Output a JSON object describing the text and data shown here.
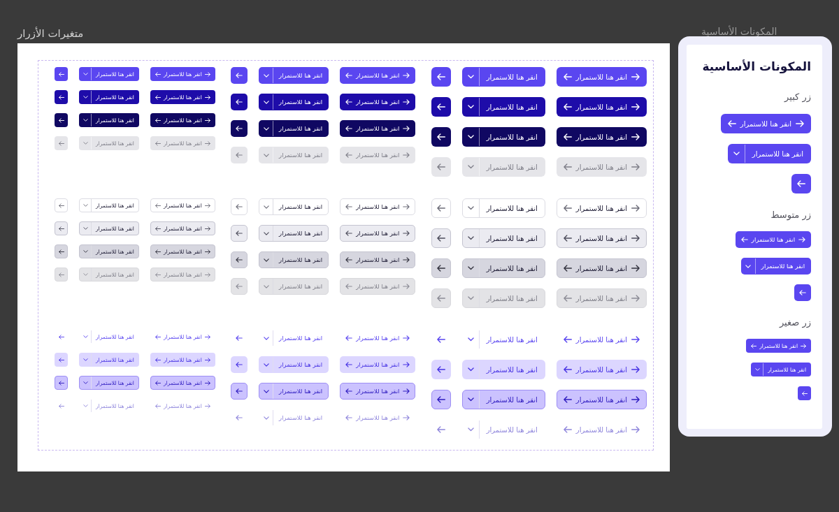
{
  "variants": {
    "title": "متغيرات الأزرار",
    "sections": [
      {
        "kind": "primary",
        "sizes": [
          {
            "kind": "large",
            "rows": [
              {
                "hovered": false,
                "pressed": false,
                "disabled": false,
                "split_label": "انقر هنا للاستمرار",
                "button_label": "انقر هنا للاستمرار"
              },
              {
                "hovered": true,
                "pressed": false,
                "disabled": false,
                "split_label": "انقر هنا للاستمرار",
                "button_label": "انقر هنا للاستمرار"
              },
              {
                "hovered": false,
                "pressed": true,
                "disabled": false,
                "split_label": "انقر هنا للاستمرار",
                "button_label": "انقر هنا للاستمرار"
              },
              {
                "hovered": false,
                "pressed": false,
                "disabled": true,
                "split_label": "انقر هنا للاستمرار",
                "button_label": "انقر هنا للاستمرار"
              }
            ]
          },
          {
            "kind": "medium",
            "rows": [
              {
                "hovered": false,
                "pressed": false,
                "disabled": false,
                "split_label": "انقر هنا للاستمرار",
                "button_label": "انقر هنا للاستمرار"
              },
              {
                "hovered": true,
                "pressed": false,
                "disabled": false,
                "split_label": "انقر هنا للاستمرار",
                "button_label": "انقر هنا للاستمرار"
              },
              {
                "hovered": false,
                "pressed": true,
                "disabled": false,
                "split_label": "انقر هنا للاستمرار",
                "button_label": "انقر هنا للاستمرار"
              },
              {
                "hovered": false,
                "pressed": false,
                "disabled": true,
                "split_label": "انقر هنا للاستمرار",
                "button_label": "انقر هنا للاستمرار"
              }
            ]
          },
          {
            "kind": "small",
            "rows": [
              {
                "hovered": false,
                "pressed": false,
                "disabled": false,
                "split_label": "انقر هنا للاستمرار",
                "button_label": "انقر هنا للاستمرار"
              },
              {
                "hovered": true,
                "pressed": false,
                "disabled": false,
                "split_label": "انقر هنا للاستمرار",
                "button_label": "انقر هنا للاستمرار"
              },
              {
                "hovered": false,
                "pressed": true,
                "disabled": false,
                "split_label": "انقر هنا للاستمرار",
                "button_label": "انقر هنا للاستمرار"
              },
              {
                "hovered": false,
                "pressed": false,
                "disabled": true,
                "split_label": "انقر هنا للاستمرار",
                "button_label": "انقر هنا للاستمرار"
              }
            ]
          }
        ]
      },
      {
        "kind": "outline",
        "sizes": [
          {
            "kind": "large",
            "rows": [
              {
                "hovered": false,
                "pressed": false,
                "disabled": false,
                "split_label": "انقر هنا للاستمرار",
                "button_label": "انقر هنا للاستمرار"
              },
              {
                "hovered": true,
                "pressed": false,
                "disabled": false,
                "split_label": "انقر هنا للاستمرار",
                "button_label": "انقر هنا للاستمرار"
              },
              {
                "hovered": false,
                "pressed": true,
                "disabled": false,
                "split_label": "انقر هنا للاستمرار",
                "button_label": "انقر هنا للاستمرار"
              },
              {
                "hovered": false,
                "pressed": false,
                "disabled": true,
                "split_label": "انقر هنا للاستمرار",
                "button_label": "انقر هنا للاستمرار"
              }
            ]
          },
          {
            "kind": "medium",
            "rows": [
              {
                "hovered": false,
                "pressed": false,
                "disabled": false,
                "split_label": "انقر هنا للاستمرار",
                "button_label": "انقر هنا للاستمرار"
              },
              {
                "hovered": true,
                "pressed": false,
                "disabled": false,
                "split_label": "انقر هنا للاستمرار",
                "button_label": "انقر هنا للاستمرار"
              },
              {
                "hovered": false,
                "pressed": true,
                "disabled": false,
                "split_label": "انقر هنا للاستمرار",
                "button_label": "انقر هنا للاستمرار"
              },
              {
                "hovered": false,
                "pressed": false,
                "disabled": true,
                "split_label": "انقر هنا للاستمرار",
                "button_label": "انقر هنا للاستمرار"
              }
            ]
          },
          {
            "kind": "small",
            "rows": [
              {
                "hovered": false,
                "pressed": false,
                "disabled": false,
                "split_label": "انقر هنا للاستمرار",
                "button_label": "انقر هنا للاستمرار"
              },
              {
                "hovered": true,
                "pressed": false,
                "disabled": false,
                "split_label": "انقر هنا للاستمرار",
                "button_label": "انقر هنا للاستمرار"
              },
              {
                "hovered": false,
                "pressed": true,
                "disabled": false,
                "split_label": "انقر هنا للاستمرار",
                "button_label": "انقر هنا للاستمرار"
              },
              {
                "hovered": false,
                "pressed": false,
                "disabled": true,
                "split_label": "انقر هنا للاستمرار",
                "button_label": "انقر هنا للاستمرار"
              }
            ]
          }
        ]
      },
      {
        "kind": "ghost",
        "sizes": [
          {
            "kind": "large",
            "rows": [
              {
                "hovered": false,
                "pressed": false,
                "disabled": false,
                "split_label": "انقر هنا للاستمرار",
                "button_label": "انقر هنا للاستمرار"
              },
              {
                "hovered": true,
                "pressed": false,
                "disabled": false,
                "split_label": "انقر هنا للاستمرار",
                "button_label": "انقر هنا للاستمرار"
              },
              {
                "hovered": false,
                "pressed": true,
                "disabled": false,
                "split_label": "انقر هنا للاستمرار",
                "button_label": "انقر هنا للاستمرار"
              },
              {
                "hovered": false,
                "pressed": false,
                "disabled": true,
                "split_label": "انقر هنا للاستمرار",
                "button_label": "انقر هنا للاستمرار"
              }
            ]
          },
          {
            "kind": "medium",
            "rows": [
              {
                "hovered": false,
                "pressed": false,
                "disabled": false,
                "split_label": "انقر هنا للاستمرار",
                "button_label": "انقر هنا للاستمرار"
              },
              {
                "hovered": true,
                "pressed": false,
                "disabled": false,
                "split_label": "انقر هنا للاستمرار",
                "button_label": "انقر هنا للاستمرار"
              },
              {
                "hovered": false,
                "pressed": true,
                "disabled": false,
                "split_label": "انقر هنا للاستمرار",
                "button_label": "انقر هنا للاستمرار"
              },
              {
                "hovered": false,
                "pressed": false,
                "disabled": true,
                "split_label": "انقر هنا للاستمرار",
                "button_label": "انقر هنا للاستمرار"
              }
            ]
          },
          {
            "kind": "small",
            "rows": [
              {
                "hovered": false,
                "pressed": false,
                "disabled": false,
                "split_label": "انقر هنا للاستمرار",
                "button_label": "انقر هنا للاستمرار"
              },
              {
                "hovered": true,
                "pressed": false,
                "disabled": false,
                "split_label": "انقر هنا للاستمرار",
                "button_label": "انقر هنا للاستمرار"
              },
              {
                "hovered": false,
                "pressed": true,
                "disabled": false,
                "split_label": "انقر هنا للاستمرار",
                "button_label": "انقر هنا للاستمرار"
              },
              {
                "hovered": false,
                "pressed": false,
                "disabled": true,
                "split_label": "انقر هنا للاستمرار",
                "button_label": "انقر هنا للاستمرار"
              }
            ]
          }
        ]
      }
    ]
  },
  "components": {
    "frame_label": "المكونات الأساسية",
    "title": "المكونات الأساسية",
    "groups": [
      {
        "label": "زر كبير",
        "kind": "large",
        "button_label": "انقر هنا للاستمرار",
        "split_label": "انقر هنا للاستمرار"
      },
      {
        "label": "زر متوسط",
        "kind": "medium",
        "button_label": "انقر هنا للاستمرار",
        "split_label": "انقر هنا للاستمرار"
      },
      {
        "label": "زر صغير",
        "kind": "small",
        "button_label": "انقر هنا للاستمرار",
        "split_label": "انقر هنا للاستمرار"
      }
    ]
  }
}
